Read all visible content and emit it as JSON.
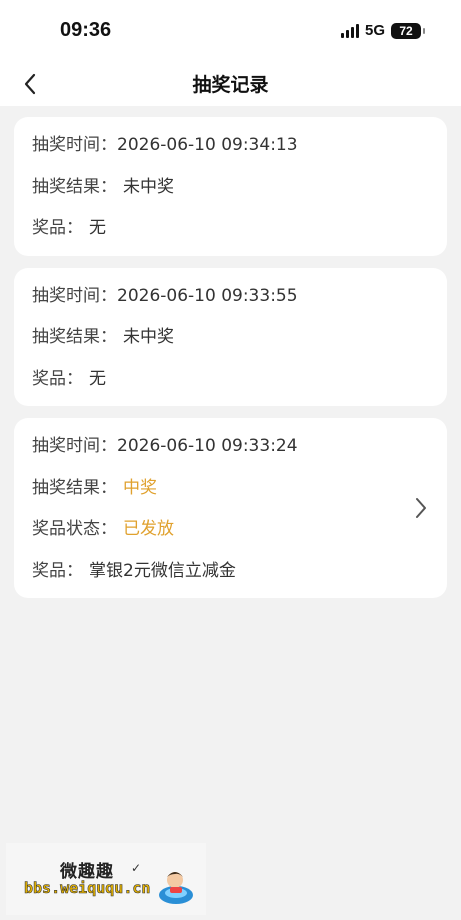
{
  "status_bar": {
    "time": "09:36",
    "network": "5G",
    "battery": "72"
  },
  "nav": {
    "title": "抽奖记录"
  },
  "records": [
    {
      "rows": [
        {
          "label": "抽奖时间：",
          "value": "2026-06-10 09:34:13"
        },
        {
          "label": "抽奖结果：",
          "value": "未中奖"
        },
        {
          "label": "奖品：",
          "value": "无"
        }
      ]
    },
    {
      "rows": [
        {
          "label": "抽奖时间：",
          "value": "2026-06-10 09:33:55"
        },
        {
          "label": "抽奖结果：",
          "value": "未中奖"
        },
        {
          "label": "奖品：",
          "value": "无"
        }
      ]
    },
    {
      "rows": [
        {
          "label": "抽奖时间：",
          "value": "2026-06-10 09:33:24"
        },
        {
          "label": "抽奖结果：",
          "value": "中奖"
        },
        {
          "label": "奖品状态：",
          "value": "已发放"
        },
        {
          "label": "奖品：",
          "value": "掌银2元微信立减金"
        }
      ]
    }
  ],
  "colors": {
    "highlight": "#e0a12e",
    "background": "#f2f2f2"
  },
  "icons": {
    "back": "chevron-left-icon",
    "detail": "chevron-right-icon"
  },
  "watermark": {
    "name": "微趣趣",
    "url": "bbs.weiququ.cn"
  }
}
